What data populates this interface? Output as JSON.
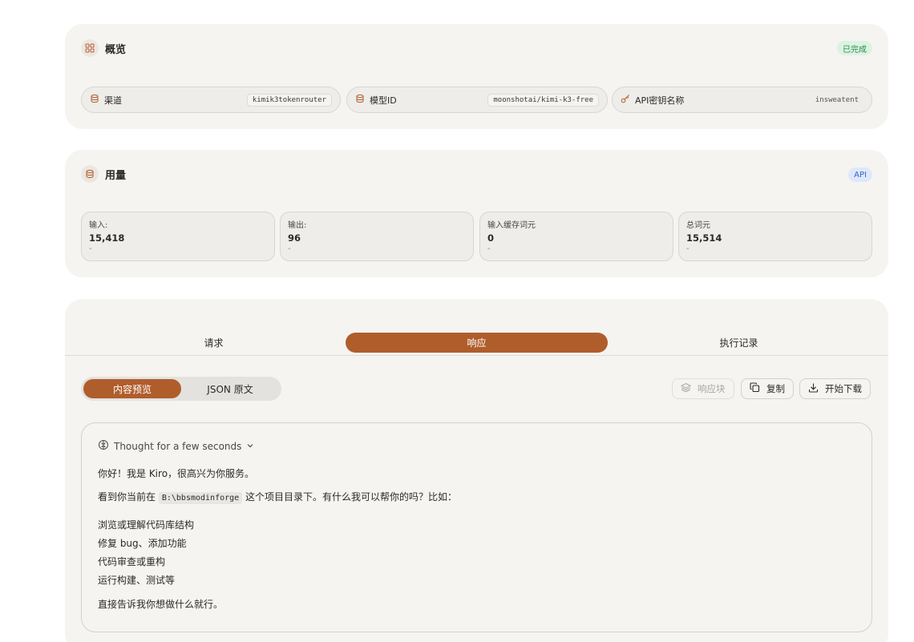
{
  "overview": {
    "title": "概览",
    "status": "已完成",
    "fields": [
      {
        "label": "渠道",
        "value": "kimik3tokenrouter",
        "icon": "database-icon"
      },
      {
        "label": "模型ID",
        "value": "moonshotai/kimi-k3-free",
        "icon": "database-icon"
      },
      {
        "label": "API密钥名称",
        "value": "insweatent",
        "icon": "key-icon"
      }
    ]
  },
  "usage": {
    "title": "用量",
    "badge": "API",
    "stats": [
      {
        "label": "输入:",
        "value": "15,418",
        "sub": "-"
      },
      {
        "label": "输出:",
        "value": "96",
        "sub": "-"
      },
      {
        "label": "输入缓存词元",
        "value": "0",
        "sub": "-"
      },
      {
        "label": "总词元",
        "value": "15,514",
        "sub": "-"
      }
    ]
  },
  "detail": {
    "tabs": [
      "请求",
      "响应",
      "执行记录"
    ],
    "active_tab": "响应",
    "view_modes": [
      "内容预览",
      "JSON 原文"
    ],
    "active_view": "内容预览",
    "toolbar": {
      "blocks_label": "响应块",
      "copy_label": "复制",
      "download_label": "开始下载"
    },
    "response": {
      "thought": "Thought for a few seconds",
      "greeting": "你好！我是 Kiro，很高兴为你服务。",
      "line2_before": "看到你当前在",
      "path": "B:\\bbsmodinforge",
      "line2_after": "这个项目目录下。有什么我可以帮你的吗？比如：",
      "items": [
        "浏览或理解代码库结构",
        "修复 bug、添加功能",
        "代码审查或重构",
        "运行构建、测试等"
      ],
      "closing": "直接告诉我你想做什么就行。"
    }
  },
  "colors": {
    "accent": "#b05d2c",
    "card_bg": "#f5f4f1",
    "success_bg": "#dcf3e3",
    "api_bg": "#dde8fb"
  }
}
